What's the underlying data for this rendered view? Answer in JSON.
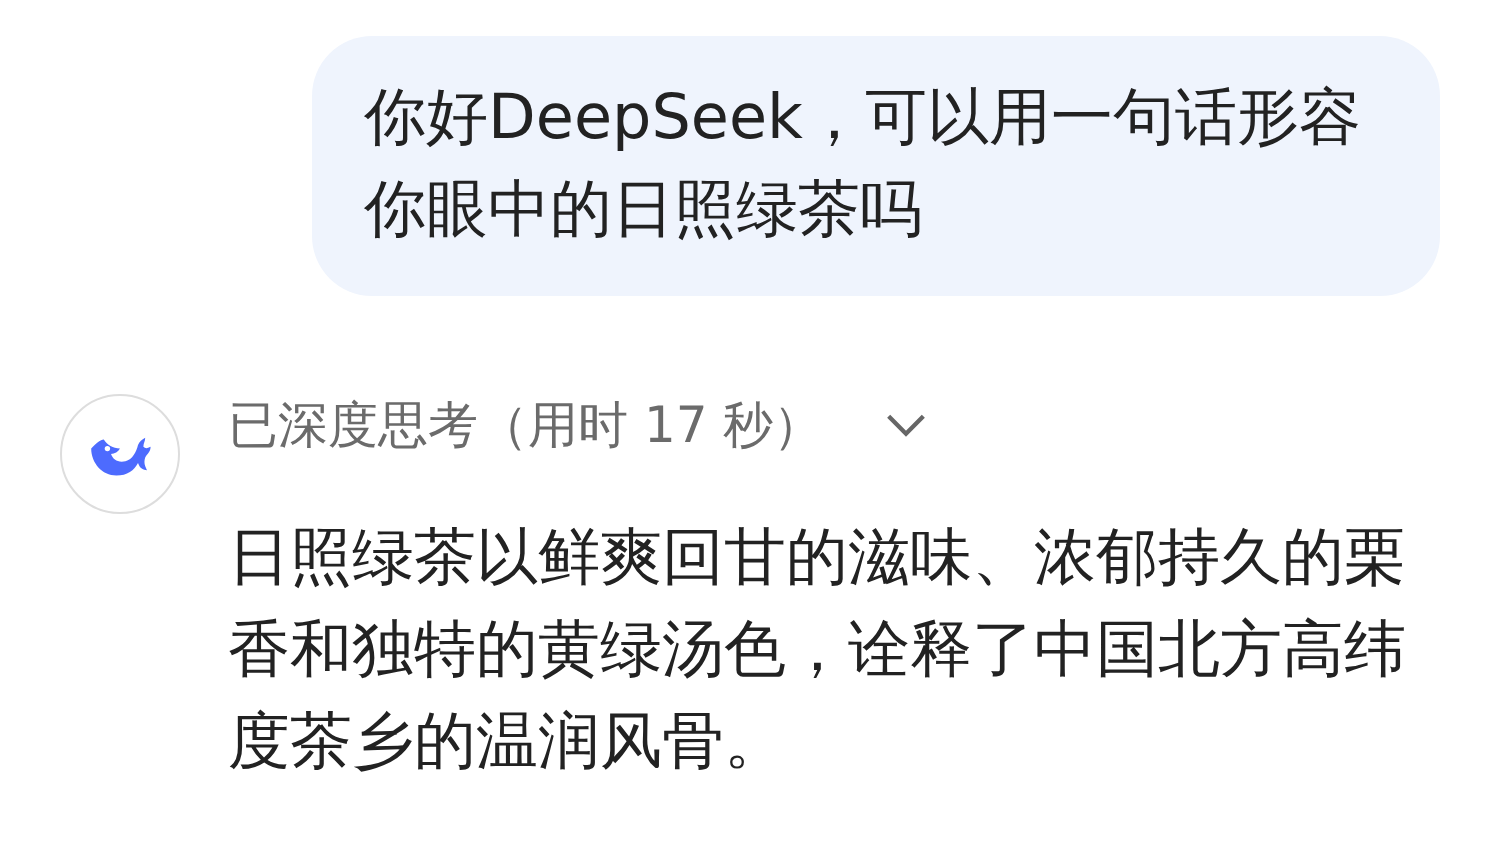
{
  "user_message": {
    "text": "你好DeepSeek，可以用一句话形容你眼中的日照绿茶吗"
  },
  "reply": {
    "thinking": {
      "label": "已深度思考（用时 17 秒）",
      "expanded": false
    },
    "text": "日照绿茶以鲜爽回甘的滋味、浓郁持久的栗香和独特的黄绿汤色，诠释了中国北方高纬度茶乡的温润风骨。"
  }
}
